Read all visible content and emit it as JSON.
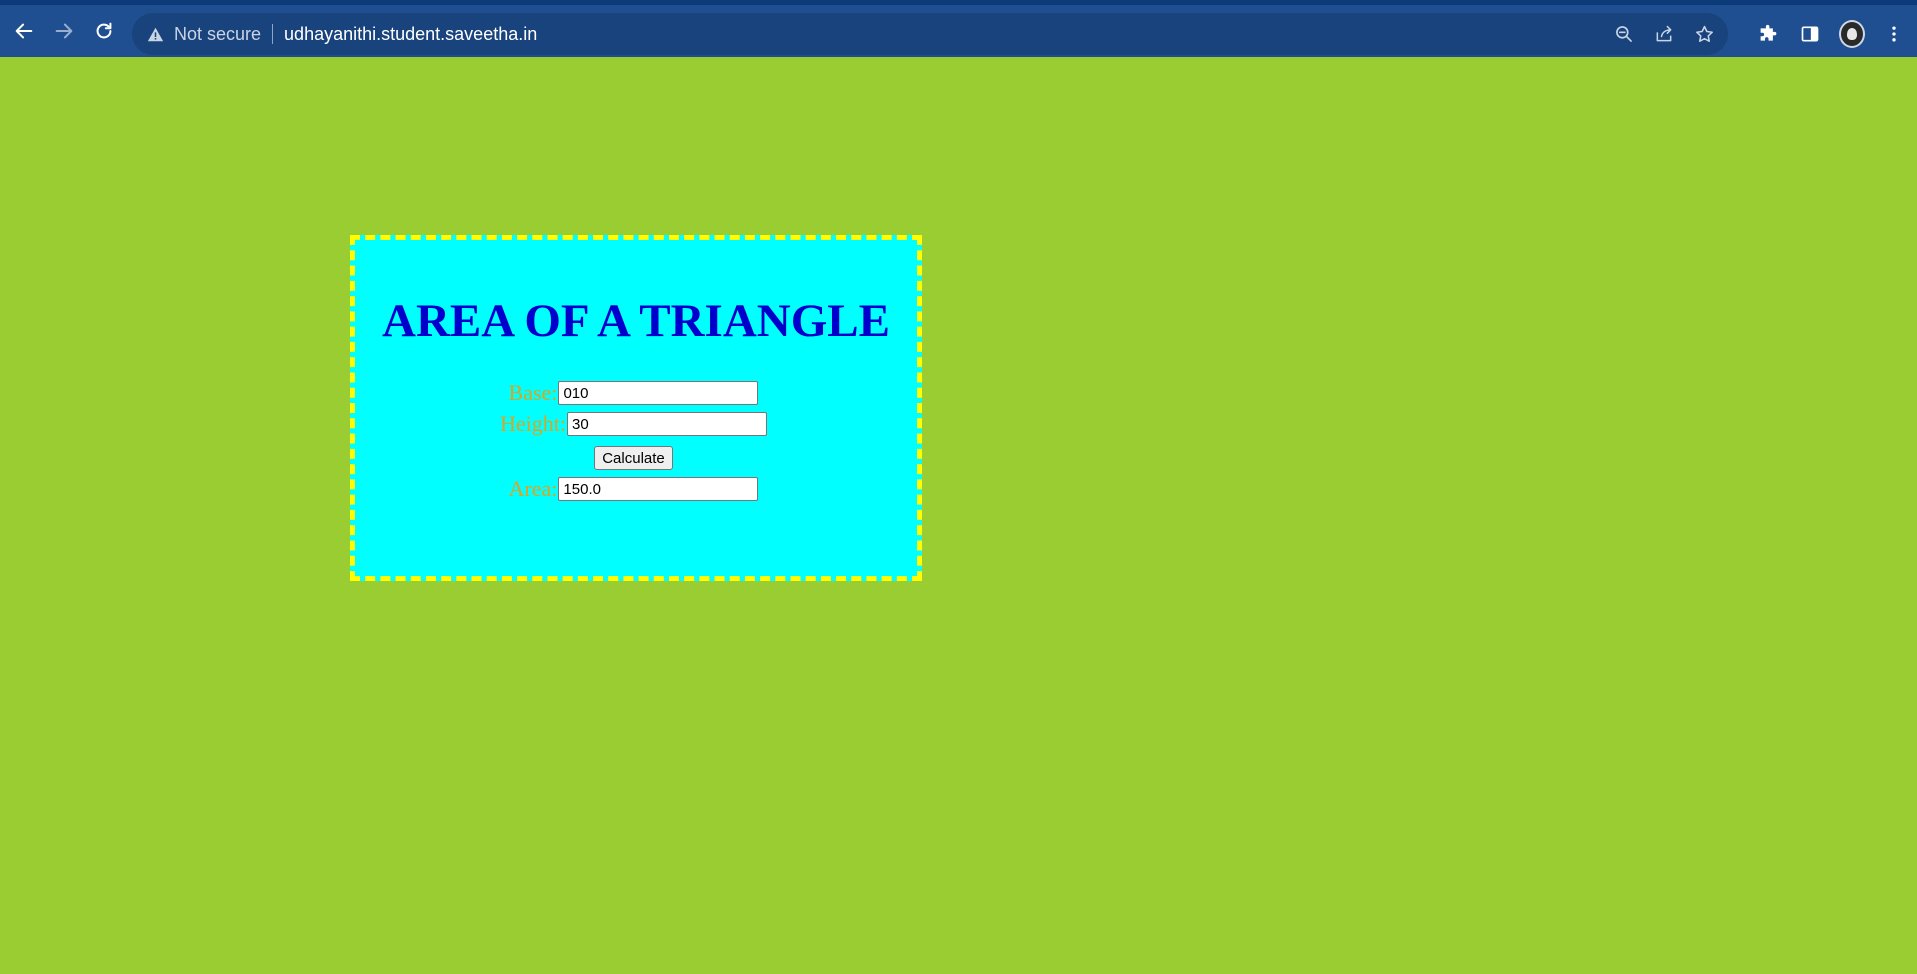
{
  "browser": {
    "security_label": "Not secure",
    "url": "udhayanithi.student.saveetha.in",
    "icons": {
      "back": "arrow-left-icon",
      "forward": "arrow-right-icon",
      "reload": "reload-icon",
      "warning": "warning-triangle-icon",
      "zoom": "zoom-out-icon",
      "share": "share-icon",
      "bookmark": "star-icon",
      "extensions": "puzzle-icon",
      "side_panel": "side-panel-icon",
      "profile": "avatar",
      "menu": "kebab-menu-icon"
    },
    "colors": {
      "toolbar": "#1f4f91",
      "omnibox": "#18437d"
    }
  },
  "page": {
    "background": "#9ACD32",
    "card_background": "#00FFFF",
    "card_border": "#FFFF00",
    "title": "AREA OF A TRIANGLE",
    "title_color": "#0000CD",
    "label_color": "#DAA520",
    "form": {
      "base_label": "Base:",
      "base_value": "010",
      "height_label": "Height:",
      "height_value": "30",
      "calculate_label": "Calculate",
      "area_label": "Area:",
      "area_value": "150.0"
    }
  }
}
